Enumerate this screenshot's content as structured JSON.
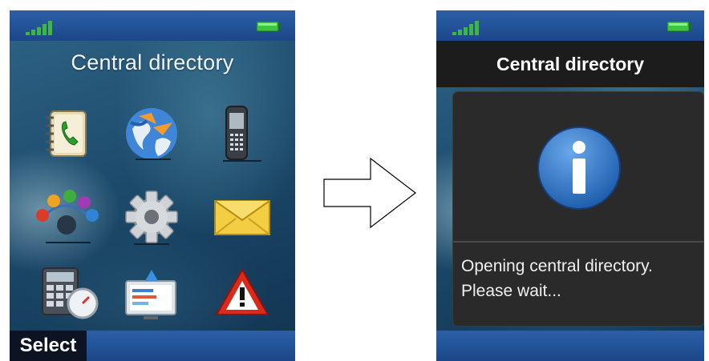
{
  "left_screen": {
    "title": "Central directory",
    "soft_key": "Select",
    "icons": [
      "phonebook-icon",
      "globe-icon",
      "handset-icon",
      "network-icon",
      "settings-gear-icon",
      "message-envelope-icon",
      "calculator-clock-icon",
      "computer-screen-icon",
      "warning-triangle-icon"
    ]
  },
  "right_screen": {
    "title": "Central directory",
    "dialog_line1": "Opening central directory.",
    "dialog_line2": "Please wait...",
    "dialog_icon": "info-icon"
  },
  "transition": {
    "icon": "arrow-right-icon"
  },
  "colors": {
    "status_bar": "#2b5fa8",
    "battery": "#3fc43f",
    "signal": "#3fb63f",
    "dialog_bg": "#2a2a2a",
    "info_blue": "#2f6fc0"
  }
}
